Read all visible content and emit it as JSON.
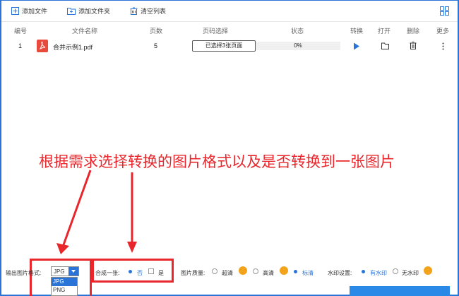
{
  "toolbar": {
    "add_file": "添加文件",
    "add_folder": "添加文件夹",
    "clear_list": "清空列表"
  },
  "table": {
    "headers": {
      "index": "编号",
      "name": "文件名称",
      "pages": "页数",
      "page_select": "页码选择",
      "status": "状态",
      "convert": "转换",
      "open": "打开",
      "delete": "删除",
      "more": "更多"
    },
    "rows": [
      {
        "index": "1",
        "name": "合并示例1.pdf",
        "pages": "5",
        "page_select": "已选择3张页面",
        "status": "0%"
      }
    ]
  },
  "annotation": "根据需求选择转换的图片格式以及是否转换到一张图片",
  "bottom": {
    "format_label": "输出图片格式:",
    "format_value": "JPG",
    "format_options": [
      "JPG",
      "PNG"
    ],
    "merge_label": "合成一张:",
    "merge_no": "否",
    "merge_yes": "是",
    "quality_label": "图片质量:",
    "quality_hd": "超清",
    "quality_high": "高清",
    "quality_std": "标清",
    "watermark_label": "水印设置:",
    "watermark_yes": "有水印",
    "watermark_no": "无水印"
  },
  "colors": {
    "accent": "#2a74d8",
    "annotation": "#e8262b",
    "vip": "#f2a21b",
    "pdf": "#e84a3c"
  }
}
